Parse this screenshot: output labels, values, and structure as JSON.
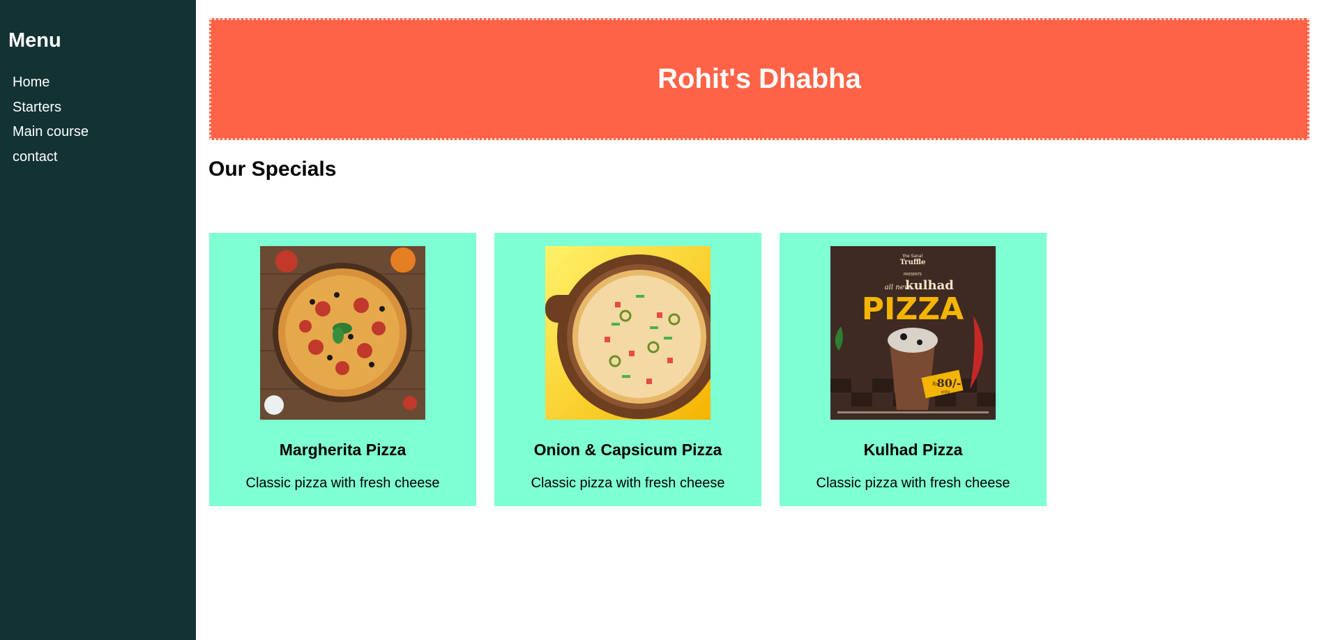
{
  "sidebar": {
    "title": "Menu",
    "items": [
      {
        "label": "Home"
      },
      {
        "label": "Starters"
      },
      {
        "label": "Main course"
      },
      {
        "label": "contact"
      }
    ]
  },
  "banner": {
    "title": "Rohit's Dhabha"
  },
  "specials": {
    "heading": "Our Specials",
    "cards": [
      {
        "name": "Margherita Pizza",
        "desc": "Classic pizza with fresh cheese"
      },
      {
        "name": "Onion & Capsicum Pizza",
        "desc": "Classic pizza with fresh cheese"
      },
      {
        "name": "Kulhad Pizza",
        "desc": "Classic pizza with fresh cheese",
        "poster": {
          "brand_top": "the Sanal",
          "brand": "Truffle",
          "presents": "PRESENTS",
          "line1": "all new",
          "line2": "kulhad",
          "line3": "PIZZA",
          "price_prefix": "Rs.",
          "price": "80/-",
          "price_suffix": "only"
        }
      }
    ]
  },
  "colors": {
    "sidebar_bg": "#133234",
    "banner_bg": "#ff6347",
    "card_bg": "#7fffd4"
  }
}
